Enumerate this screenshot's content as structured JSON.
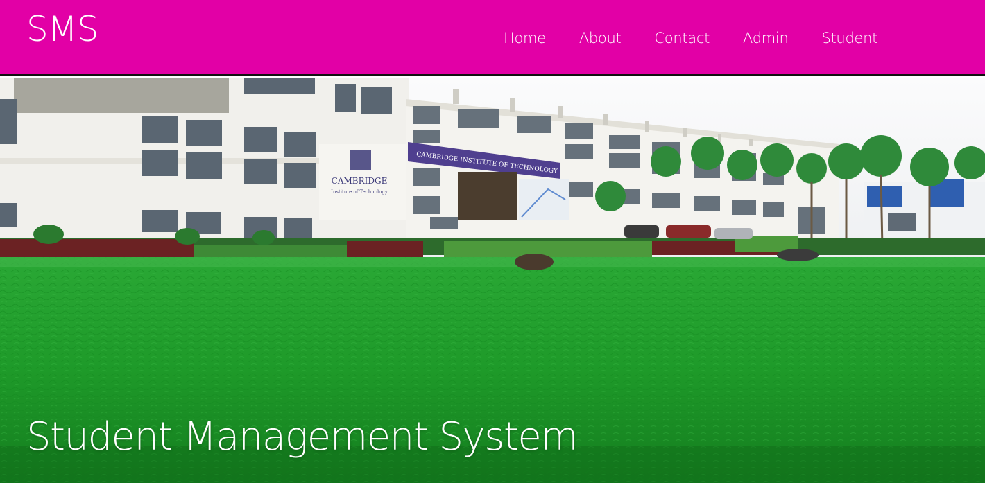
{
  "navbar": {
    "brand": "SMS",
    "links": [
      {
        "label": "Home"
      },
      {
        "label": "About"
      },
      {
        "label": "Contact"
      },
      {
        "label": "Admin"
      },
      {
        "label": "Student"
      }
    ]
  },
  "hero": {
    "title": "Student Management System",
    "building_sign": "CAMBRIDGE INSTITUTE OF TECHNOLOGY",
    "building_logo_text": "CAMBRIDGE",
    "building_logo_sub": "Institute of Technology"
  },
  "colors": {
    "navbar_bg": "#e200a6",
    "lawn": "#1f9a2a",
    "sky": "#f6f7f9"
  }
}
